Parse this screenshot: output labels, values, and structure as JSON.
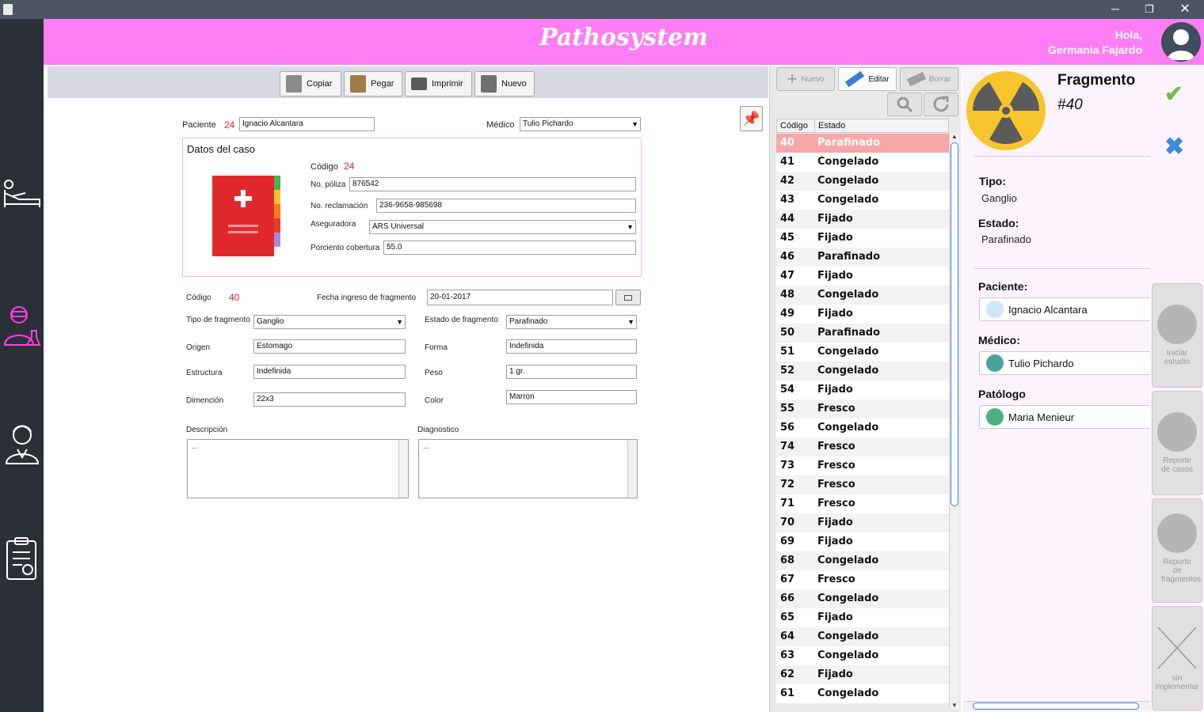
{
  "window": {
    "greeting_line1": "Hola,",
    "greeting_line2": "Germania Fajardo",
    "brand": "Pathosystem"
  },
  "toolbar": {
    "copy": "Copiar",
    "paste": "Pegar",
    "print": "Imprimir",
    "new": "Nuevo"
  },
  "case": {
    "patient_label": "Paciente",
    "patient_id": "24",
    "patient_name": "Ignacio Alcantara",
    "doctor_label": "Médico",
    "doctor_name": "Tulio Pichardo",
    "section_title": "Datos del caso",
    "code_label": "Código",
    "code_value": "24",
    "policy_label": "No. póliza",
    "policy_value": "876542",
    "claim_label": "No. reclamación",
    "claim_value": "236-9658-985698",
    "insurer_label": "Aseguradora",
    "insurer_value": "ARS Universal",
    "coverage_label": "Porciento cobertura",
    "coverage_value": "55.0"
  },
  "fragment": {
    "code_label": "Código",
    "code_value": "40",
    "date_label": "Fecha ingreso de fragmento",
    "date_value": "20-01-2017",
    "type_label": "Tipo de fragmento",
    "type_value": "Ganglio",
    "state_label": "Estado de fragmento",
    "state_value": "Parafinado",
    "origin_label": "Origen",
    "origin_value": "Estomago",
    "shape_label": "Forma",
    "shape_value": "Indefinida",
    "structure_label": "Estructura",
    "structure_value": "Indefinida",
    "weight_label": "Peso",
    "weight_value": "1 gr.",
    "dimension_label": "Dimención",
    "dimension_value": "22x3",
    "color_label": "Color",
    "color_value": "Marron",
    "description_label": "Descripción",
    "description_value": "...",
    "diagnosis_label": "Diagnostico",
    "diagnosis_value": "..."
  },
  "list": {
    "new": "Nuevo",
    "edit": "Editar",
    "delete": "Borrar",
    "col_code": "Código",
    "col_state": "Estado",
    "rows": [
      [
        "40",
        "Parafinado"
      ],
      [
        "41",
        "Congelado"
      ],
      [
        "42",
        "Congelado"
      ],
      [
        "43",
        "Congelado"
      ],
      [
        "44",
        "Fijado"
      ],
      [
        "45",
        "Fijado"
      ],
      [
        "46",
        "Parafinado"
      ],
      [
        "47",
        "Fijado"
      ],
      [
        "48",
        "Congelado"
      ],
      [
        "49",
        "Fijado"
      ],
      [
        "50",
        "Parafinado"
      ],
      [
        "51",
        "Congelado"
      ],
      [
        "52",
        "Congelado"
      ],
      [
        "54",
        "Fijado"
      ],
      [
        "55",
        "Fresco"
      ],
      [
        "56",
        "Congelado"
      ],
      [
        "74",
        "Fresco"
      ],
      [
        "73",
        "Fresco"
      ],
      [
        "72",
        "Fresco"
      ],
      [
        "71",
        "Fresco"
      ],
      [
        "70",
        "Fijado"
      ],
      [
        "69",
        "Fijado"
      ],
      [
        "68",
        "Congelado"
      ],
      [
        "67",
        "Fresco"
      ],
      [
        "66",
        "Congelado"
      ],
      [
        "65",
        "Fijado"
      ],
      [
        "64",
        "Congelado"
      ],
      [
        "63",
        "Congelado"
      ],
      [
        "62",
        "Fijado"
      ],
      [
        "61",
        "Congelado"
      ]
    ]
  },
  "detail": {
    "title": "Fragmento",
    "number": "#40",
    "type_label": "Tipo:",
    "type_value": "Ganglio",
    "state_label": "Estado:",
    "state_value": "Parafinado",
    "patient_label": "Paciente:",
    "patient_value": "Ignacio Alcantara",
    "doctor_label": "Médico:",
    "doctor_value": "Tulio Pichardo",
    "pathologist_label": "Patólogo",
    "pathologist_value": "Maria Menieur"
  },
  "actions": {
    "start": "Iniciar estudio",
    "case_report": "Reporte de casos",
    "fragment_report": "Reporte de fragmentos",
    "unimplemented": "sin implementar"
  },
  "colors": {
    "header": "#ff7ef5",
    "selected_row": "#f9a6a6",
    "sidebar": "#2b3038"
  }
}
